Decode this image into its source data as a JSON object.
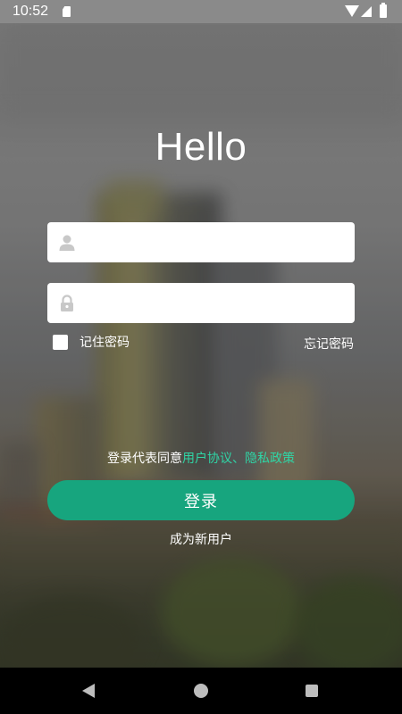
{
  "status_bar": {
    "time": "10:52"
  },
  "login": {
    "title": "Hello",
    "username": {
      "value": "",
      "placeholder": ""
    },
    "password": {
      "value": "",
      "placeholder": ""
    },
    "remember_label": "记住密码",
    "remember_checked": false,
    "forgot_label": "忘记密码",
    "agreement_prefix": "登录代表同意",
    "agreement_link": "用户协议、隐私政策",
    "submit_label": "登录",
    "register_label": "成为新用户"
  },
  "colors": {
    "accent": "#17a57e",
    "link": "#2fd6a6"
  },
  "icons": {
    "username": "user-icon",
    "password": "lock-icon",
    "nav_back": "back-triangle-icon",
    "nav_home": "home-circle-icon",
    "nav_recents": "recents-square-icon"
  }
}
